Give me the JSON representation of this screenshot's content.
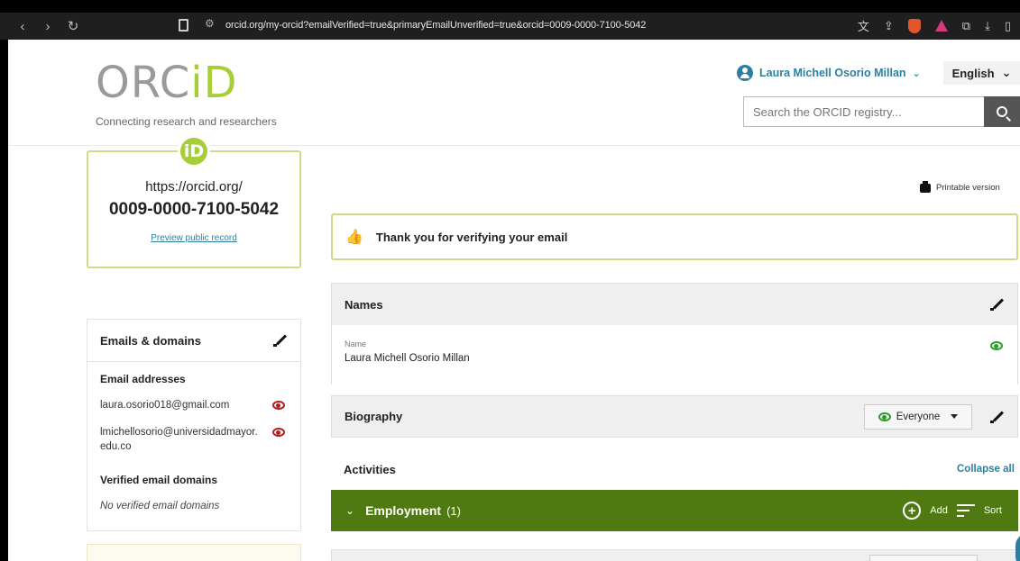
{
  "browser": {
    "url": "orcid.org/my-orcid?emailVerified=true&primaryEmailUnverified=true&orcid=0009-0000-7100-5042"
  },
  "header": {
    "logo_text_left": "ORC",
    "logo_text_right": "iD",
    "tagline": "Connecting research and researchers",
    "user_name": "Laura Michell Osorio Millan",
    "language": "English",
    "search_placeholder": "Search the ORCID registry..."
  },
  "id_card": {
    "badge": "iD",
    "url_prefix": "https://orcid.org/",
    "orcid": "0009-0000-7100-5042",
    "preview_link": "Preview public record"
  },
  "emails": {
    "title": "Emails & domains",
    "addresses_label": "Email addresses",
    "addresses": [
      "laura.osorio018@gmail.com",
      "lmichellosorio@universidadmayor.edu.co"
    ],
    "verified_label": "Verified email domains",
    "no_domains": "No verified email domains"
  },
  "main": {
    "printable": "Printable version",
    "notice": "Thank you for verifying your email",
    "names": {
      "title": "Names",
      "field_label": "Name",
      "value": "Laura Michell Osorio Millan"
    },
    "biography": {
      "title": "Biography",
      "visibility": "Everyone"
    },
    "activities_label": "Activities",
    "collapse_all": "Collapse all",
    "employment": {
      "title": "Employment",
      "count": "(1)",
      "add": "Add",
      "sort": "Sort"
    }
  },
  "colors": {
    "orcid_green": "#a6ce39",
    "link_blue": "#2e7f9f",
    "employment_bar": "#4f7a11",
    "visibility_private": "#b01e1e",
    "visibility_public": "#2d9a2d"
  }
}
